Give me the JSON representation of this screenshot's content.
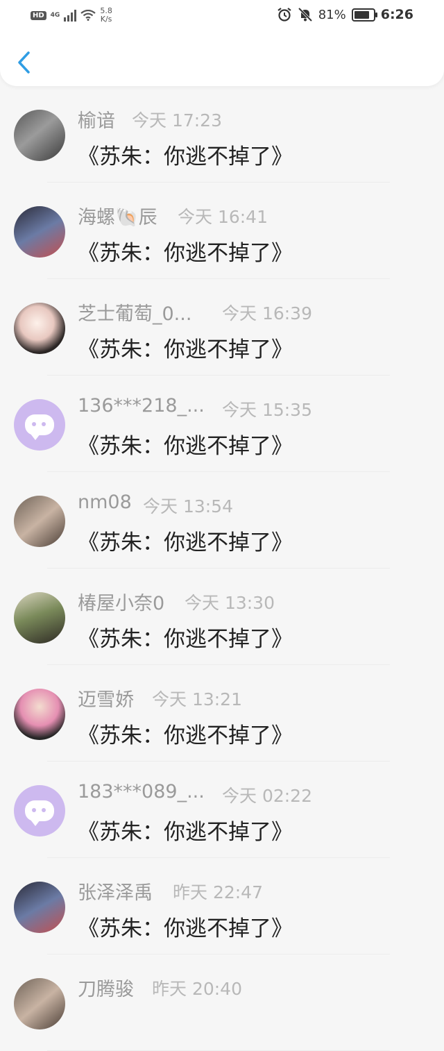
{
  "status_bar": {
    "hd": "HD",
    "network": "4G",
    "speed_value": "5.8",
    "speed_unit": "K/s",
    "battery": "81%",
    "battery_level": 0.81,
    "time": "6:26"
  },
  "colors": {
    "accent": "#2f9de4",
    "placeholder_avatar": "#cdb9ef"
  },
  "messages": [
    {
      "name": "榆谙",
      "time": "今天 17:23",
      "text": "《苏朱：你逃不掉了》",
      "avatar": "photo"
    },
    {
      "name": "海螺🐚辰",
      "time": "今天 16:41",
      "text": "《苏朱：你逃不掉了》",
      "avatar": "photo"
    },
    {
      "name": "芝士葡萄_0...",
      "time": "今天 16:39",
      "text": "《苏朱：你逃不掉了》",
      "avatar": "photo"
    },
    {
      "name": "136***218_...",
      "time": "今天 15:35",
      "text": "《苏朱：你逃不掉了》",
      "avatar": "placeholder"
    },
    {
      "name": "nm08",
      "time": "今天 13:54",
      "text": "《苏朱：你逃不掉了》",
      "avatar": "photo"
    },
    {
      "name": "椿屋小奈0",
      "time": "今天 13:30",
      "text": "《苏朱：你逃不掉了》",
      "avatar": "photo"
    },
    {
      "name": "迈雪娇",
      "time": "今天 13:21",
      "text": "《苏朱：你逃不掉了》",
      "avatar": "photo"
    },
    {
      "name": "183***089_...",
      "time": "今天 02:22",
      "text": "《苏朱：你逃不掉了》",
      "avatar": "placeholder"
    },
    {
      "name": "张泽泽禹",
      "time": "昨天 22:47",
      "text": "《苏朱：你逃不掉了》",
      "avatar": "photo"
    },
    {
      "name": "刀腾骏",
      "time": "昨天 20:40",
      "text": "",
      "avatar": "photo"
    }
  ]
}
